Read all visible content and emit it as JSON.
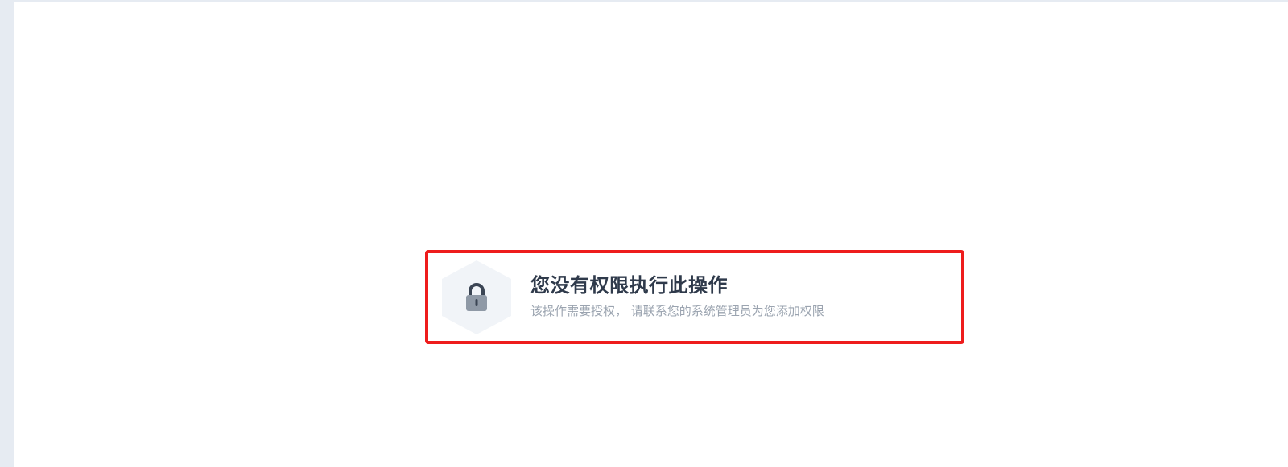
{
  "notice": {
    "icon": "lock-icon",
    "title": "您没有权限执行此操作",
    "description": "该操作需要授权， 请联系您的系统管理员为您添加权限"
  },
  "colors": {
    "page_background": "#e6ebf2",
    "panel_background": "#ffffff",
    "highlight_border": "#ee1c1c",
    "hexagon_fill": "#f1f4f8",
    "lock_color": "#8f99a6",
    "title_color": "#2f3a4b",
    "description_color": "#9ba4b0"
  }
}
